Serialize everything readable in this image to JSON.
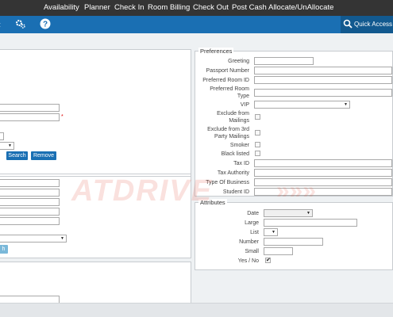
{
  "topnav": {
    "items": [
      "Availability",
      "Planner",
      "Check In",
      "Room Billing",
      "Check Out",
      "Post Cash",
      "Allocate/UnAllocate"
    ]
  },
  "toolbar": {
    "quick_access": "Quick Access",
    "icons": [
      "chevron-icon",
      "gears-icon",
      "help-icon",
      "search-icon"
    ]
  },
  "left_panel": {
    "required_marker": "*",
    "search_button": "Search",
    "remove_button": "Remove",
    "partial_button": "h"
  },
  "preferences": {
    "title": "Preferences",
    "fields": {
      "greeting": "Greeting",
      "passport": "Passport Number",
      "preferred_room_id": "Preferred Room ID",
      "preferred_room_type_1": "Preferred Room",
      "preferred_room_type_2": "Type",
      "vip": "VIP",
      "exclude_mailings_1": "Exclude from",
      "exclude_mailings_2": "Mailings",
      "exclude_3rd_1": "Exclude from 3rd",
      "exclude_3rd_2": "Party Mailings",
      "smoker": "Smoker",
      "black_listed": "Black listed",
      "tax_id": "Tax ID",
      "tax_authority": "Tax Authority",
      "type_of_business": "Type Of Business",
      "student_id": "Student ID"
    }
  },
  "attributes": {
    "title": "Attributes",
    "fields": {
      "date": "Date",
      "large": "Large",
      "list": "List",
      "number": "Number",
      "small": "Small",
      "yes_no": "Yes / No"
    },
    "yes_no_checked": true
  },
  "watermark": {
    "text": "ATDRIVE",
    "arrows": "»»»"
  },
  "colors": {
    "nav_bg": "#343434",
    "toolbar_bg": "#1a6fb3",
    "accent": "#1a6fb3"
  }
}
